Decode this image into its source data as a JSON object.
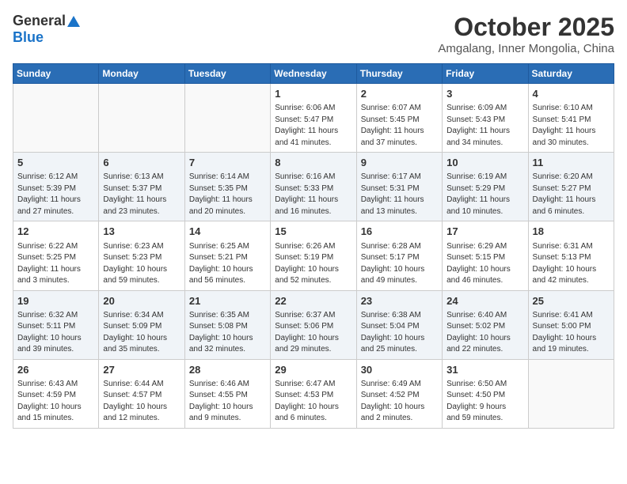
{
  "header": {
    "logo_general": "General",
    "logo_blue": "Blue",
    "month": "October 2025",
    "location": "Amgalang, Inner Mongolia, China"
  },
  "weekdays": [
    "Sunday",
    "Monday",
    "Tuesday",
    "Wednesday",
    "Thursday",
    "Friday",
    "Saturday"
  ],
  "weeks": [
    [
      {
        "day": "",
        "info": ""
      },
      {
        "day": "",
        "info": ""
      },
      {
        "day": "",
        "info": ""
      },
      {
        "day": "1",
        "info": "Sunrise: 6:06 AM\nSunset: 5:47 PM\nDaylight: 11 hours\nand 41 minutes."
      },
      {
        "day": "2",
        "info": "Sunrise: 6:07 AM\nSunset: 5:45 PM\nDaylight: 11 hours\nand 37 minutes."
      },
      {
        "day": "3",
        "info": "Sunrise: 6:09 AM\nSunset: 5:43 PM\nDaylight: 11 hours\nand 34 minutes."
      },
      {
        "day": "4",
        "info": "Sunrise: 6:10 AM\nSunset: 5:41 PM\nDaylight: 11 hours\nand 30 minutes."
      }
    ],
    [
      {
        "day": "5",
        "info": "Sunrise: 6:12 AM\nSunset: 5:39 PM\nDaylight: 11 hours\nand 27 minutes."
      },
      {
        "day": "6",
        "info": "Sunrise: 6:13 AM\nSunset: 5:37 PM\nDaylight: 11 hours\nand 23 minutes."
      },
      {
        "day": "7",
        "info": "Sunrise: 6:14 AM\nSunset: 5:35 PM\nDaylight: 11 hours\nand 20 minutes."
      },
      {
        "day": "8",
        "info": "Sunrise: 6:16 AM\nSunset: 5:33 PM\nDaylight: 11 hours\nand 16 minutes."
      },
      {
        "day": "9",
        "info": "Sunrise: 6:17 AM\nSunset: 5:31 PM\nDaylight: 11 hours\nand 13 minutes."
      },
      {
        "day": "10",
        "info": "Sunrise: 6:19 AM\nSunset: 5:29 PM\nDaylight: 11 hours\nand 10 minutes."
      },
      {
        "day": "11",
        "info": "Sunrise: 6:20 AM\nSunset: 5:27 PM\nDaylight: 11 hours\nand 6 minutes."
      }
    ],
    [
      {
        "day": "12",
        "info": "Sunrise: 6:22 AM\nSunset: 5:25 PM\nDaylight: 11 hours\nand 3 minutes."
      },
      {
        "day": "13",
        "info": "Sunrise: 6:23 AM\nSunset: 5:23 PM\nDaylight: 10 hours\nand 59 minutes."
      },
      {
        "day": "14",
        "info": "Sunrise: 6:25 AM\nSunset: 5:21 PM\nDaylight: 10 hours\nand 56 minutes."
      },
      {
        "day": "15",
        "info": "Sunrise: 6:26 AM\nSunset: 5:19 PM\nDaylight: 10 hours\nand 52 minutes."
      },
      {
        "day": "16",
        "info": "Sunrise: 6:28 AM\nSunset: 5:17 PM\nDaylight: 10 hours\nand 49 minutes."
      },
      {
        "day": "17",
        "info": "Sunrise: 6:29 AM\nSunset: 5:15 PM\nDaylight: 10 hours\nand 46 minutes."
      },
      {
        "day": "18",
        "info": "Sunrise: 6:31 AM\nSunset: 5:13 PM\nDaylight: 10 hours\nand 42 minutes."
      }
    ],
    [
      {
        "day": "19",
        "info": "Sunrise: 6:32 AM\nSunset: 5:11 PM\nDaylight: 10 hours\nand 39 minutes."
      },
      {
        "day": "20",
        "info": "Sunrise: 6:34 AM\nSunset: 5:09 PM\nDaylight: 10 hours\nand 35 minutes."
      },
      {
        "day": "21",
        "info": "Sunrise: 6:35 AM\nSunset: 5:08 PM\nDaylight: 10 hours\nand 32 minutes."
      },
      {
        "day": "22",
        "info": "Sunrise: 6:37 AM\nSunset: 5:06 PM\nDaylight: 10 hours\nand 29 minutes."
      },
      {
        "day": "23",
        "info": "Sunrise: 6:38 AM\nSunset: 5:04 PM\nDaylight: 10 hours\nand 25 minutes."
      },
      {
        "day": "24",
        "info": "Sunrise: 6:40 AM\nSunset: 5:02 PM\nDaylight: 10 hours\nand 22 minutes."
      },
      {
        "day": "25",
        "info": "Sunrise: 6:41 AM\nSunset: 5:00 PM\nDaylight: 10 hours\nand 19 minutes."
      }
    ],
    [
      {
        "day": "26",
        "info": "Sunrise: 6:43 AM\nSunset: 4:59 PM\nDaylight: 10 hours\nand 15 minutes."
      },
      {
        "day": "27",
        "info": "Sunrise: 6:44 AM\nSunset: 4:57 PM\nDaylight: 10 hours\nand 12 minutes."
      },
      {
        "day": "28",
        "info": "Sunrise: 6:46 AM\nSunset: 4:55 PM\nDaylight: 10 hours\nand 9 minutes."
      },
      {
        "day": "29",
        "info": "Sunrise: 6:47 AM\nSunset: 4:53 PM\nDaylight: 10 hours\nand 6 minutes."
      },
      {
        "day": "30",
        "info": "Sunrise: 6:49 AM\nSunset: 4:52 PM\nDaylight: 10 hours\nand 2 minutes."
      },
      {
        "day": "31",
        "info": "Sunrise: 6:50 AM\nSunset: 4:50 PM\nDaylight: 9 hours\nand 59 minutes."
      },
      {
        "day": "",
        "info": ""
      }
    ]
  ]
}
